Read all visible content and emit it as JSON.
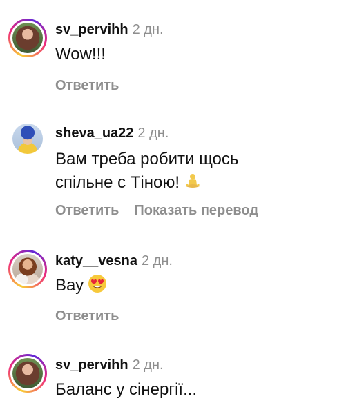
{
  "colors": {
    "username": "#111111",
    "secondary": "#8e8e8e",
    "story_ring": [
      "#f9ce34",
      "#ee2a7b",
      "#6228d7"
    ]
  },
  "comments": [
    {
      "username": "sv_pervihh",
      "time": "2 дн.",
      "text": "Wow!!!",
      "reply_label": "Ответить",
      "has_story_ring": true,
      "avatar_icon": "user-avatar-photo"
    },
    {
      "username": "sheva_ua22",
      "time": "2 дн.",
      "text_line1": "Вам треба робити щось",
      "text_line2": "спільне с Тіною!",
      "emoji_icon": "person-in-lotus-position-emoji",
      "reply_label": "Ответить",
      "translate_label": "Показать перевод",
      "has_story_ring": false,
      "avatar_icon": "user-avatar-photo"
    },
    {
      "username": "katy__vesna",
      "time": "2 дн.",
      "text": "Вау",
      "emoji_icon": "heart-eyes-emoji",
      "reply_label": "Ответить",
      "has_story_ring": true,
      "avatar_icon": "user-avatar-photo"
    },
    {
      "username": "sv_pervihh",
      "time": "2 дн.",
      "text": "Баланс у сінергії...",
      "has_story_ring": true,
      "avatar_icon": "user-avatar-photo"
    }
  ]
}
